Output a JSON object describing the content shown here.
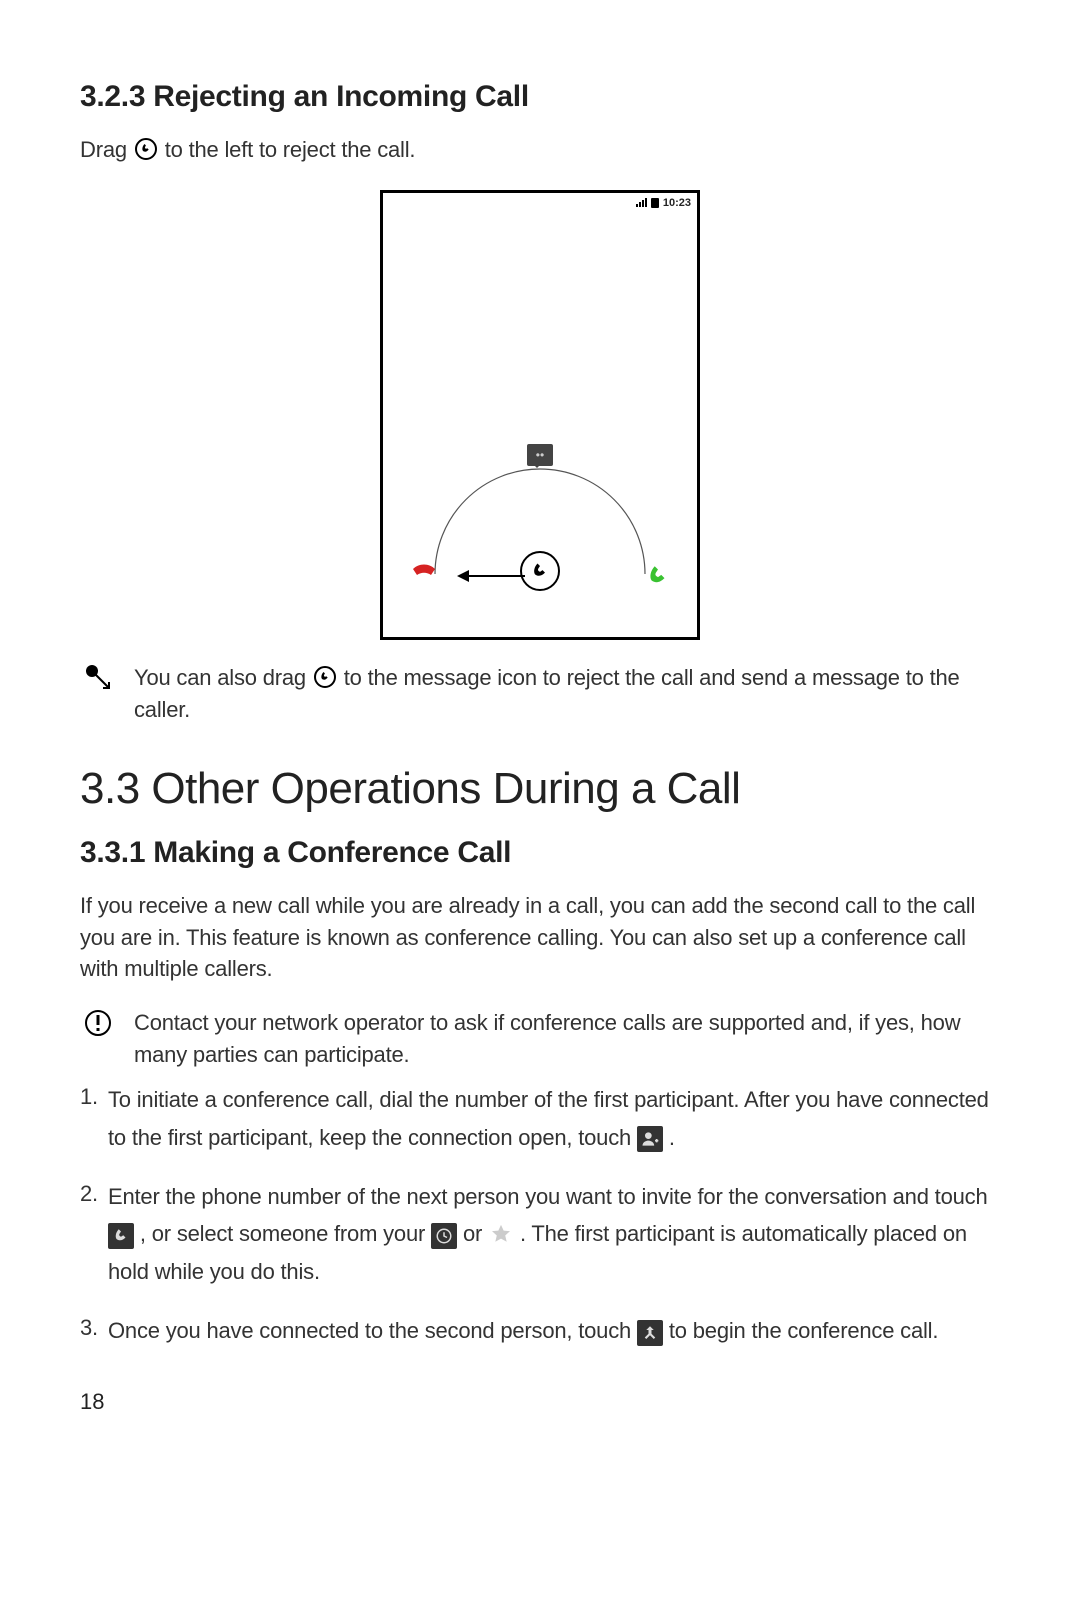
{
  "section_323": {
    "heading": "3.2.3  Rejecting an Incoming Call",
    "drag_pre": "Drag ",
    "drag_post": " to the left to reject the call.",
    "statusbar_time": "10:23",
    "tip_pre": "You can also drag ",
    "tip_post": " to the message icon to reject the call and send a message to the caller."
  },
  "section_33": {
    "heading": "3.3  Other Operations During a Call"
  },
  "section_331": {
    "heading": "3.3.1  Making a Conference Call",
    "intro": "If you receive a new call while you are already in a call, you can add the second call to the call you are in. This feature is known as conference calling. You can also set up a conference call with multiple callers.",
    "warning": "Contact your network operator to ask if conference calls are supported and, if yes, how many parties can participate.",
    "step1_a": "To initiate a conference call, dial the number of the first participant. After you have connected to the first participant, keep the connection open, touch ",
    "step1_b": " .",
    "step2_a": "Enter the phone number of the next person you want to invite for the conversation and touch ",
    "step2_b": " , or select someone from your ",
    "step2_c": " or ",
    "step2_d": " . The first participant is automatically placed on hold while you do this.",
    "step3_a": "Once you have connected to the second person, touch ",
    "step3_b": " to begin the conference call."
  },
  "page_number": "18"
}
